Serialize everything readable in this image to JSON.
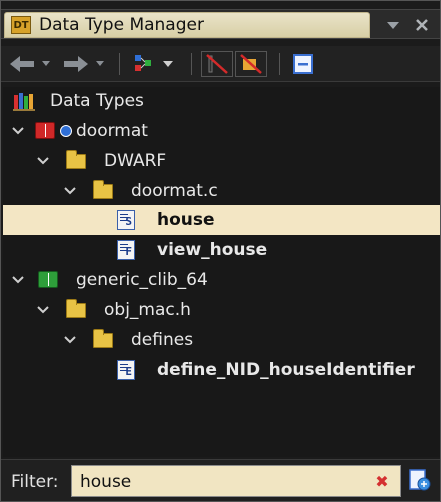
{
  "window": {
    "title": "Data Type Manager",
    "logo_text": "DT",
    "menu_icon": "chevron-down-icon",
    "close_icon": "close-icon"
  },
  "toolbar": {
    "items": [
      {
        "name": "back-button",
        "icon": "arrow-left-icon"
      },
      {
        "name": "back-dropdown",
        "icon": "chevron-down-icon"
      },
      {
        "name": "forward-button",
        "icon": "arrow-right-icon"
      },
      {
        "name": "forward-dropdown",
        "icon": "chevron-down-icon"
      },
      {
        "name": "archive-menu-button",
        "icon": "network-icon"
      },
      {
        "name": "filter-arrays-button",
        "icon": "filter-arrays-icon"
      },
      {
        "name": "filter-pointers-button",
        "icon": "filter-pointers-icon"
      },
      {
        "name": "collapse-all-button",
        "icon": "collapse-all-icon"
      }
    ]
  },
  "tree": {
    "root_label": "Data Types",
    "nodes": [
      {
        "label": "doormat",
        "icon": "program-archive-icon",
        "bold": false
      },
      {
        "label": "DWARF",
        "icon": "folder-icon",
        "bold": false
      },
      {
        "label": "doormat.c",
        "icon": "folder-icon",
        "bold": false
      },
      {
        "label": "house",
        "icon": "structure-icon",
        "bold": true,
        "selected": true,
        "letter": "S"
      },
      {
        "label": "view_house",
        "icon": "function-definition-icon",
        "bold": true,
        "letter": "F"
      },
      {
        "label": "generic_clib_64",
        "icon": "file-archive-icon",
        "bold": false
      },
      {
        "label": "obj_mac.h",
        "icon": "folder-icon",
        "bold": false
      },
      {
        "label": "defines",
        "icon": "folder-icon",
        "bold": false
      },
      {
        "label": "define_NID_houseIdentifier",
        "icon": "enum-icon",
        "bold": true,
        "letter": "E"
      }
    ]
  },
  "filter": {
    "label": "Filter:",
    "value": "house"
  },
  "colors": {
    "selected_row": "#f3e6c4",
    "filter_background": "#f1e5c2",
    "title_tab": "#e9e3c8"
  }
}
